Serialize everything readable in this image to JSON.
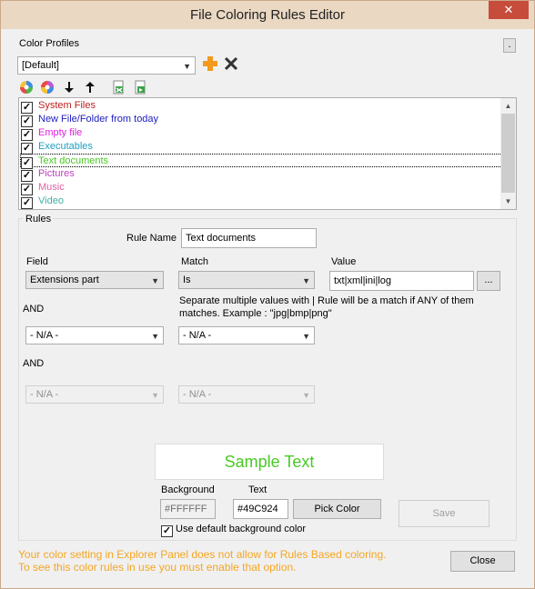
{
  "window": {
    "title": "File Coloring Rules Editor",
    "close_glyph": "✕"
  },
  "profiles": {
    "label": "Color Profiles",
    "dot_button": ".",
    "selected": "[Default]"
  },
  "items": [
    {
      "label": "System Files",
      "color": "#c02020",
      "checked": true
    },
    {
      "label": "New File/Folder from today",
      "color": "#2020c0",
      "checked": true
    },
    {
      "label": "Empty file",
      "color": "#e020e0",
      "checked": true
    },
    {
      "label": "Executables",
      "color": "#20a0c0",
      "checked": true
    },
    {
      "label": "Text documents",
      "color": "#49C924",
      "checked": true
    },
    {
      "label": "Pictures",
      "color": "#c040c0",
      "checked": true
    },
    {
      "label": "Music",
      "color": "#e060a0",
      "checked": true
    },
    {
      "label": "Video",
      "color": "#40b0a0",
      "checked": true
    }
  ],
  "rules": {
    "group_label": "Rules",
    "rule_name_label": "Rule Name",
    "rule_name_value": "Text documents",
    "field_label": "Field",
    "match_label": "Match",
    "value_label": "Value",
    "field_value": "Extensions part",
    "match_value": "Is",
    "value_value": "txt|xml|ini|log",
    "value_browse": "...",
    "hint": "Separate multiple values with | Rule will be a match if ANY of them matches. Example : \"jpg|bmp|png\"",
    "and1": "AND",
    "and2": "AND",
    "na1_field": "- N/A -",
    "na1_match": "- N/A -",
    "na2_field": "- N/A -",
    "na2_match": "- N/A -"
  },
  "sample": {
    "text": "Sample Text",
    "color": "#49C924",
    "background_label": "Background",
    "text_label": "Text",
    "background_value": "#FFFFFF",
    "text_value": "#49C924",
    "pick_color": "Pick Color",
    "save": "Save",
    "use_default_bg": "Use default background color"
  },
  "warning": {
    "line1": "Your color setting in Explorer Panel does not allow for Rules Based coloring.",
    "line2": "To see this color rules in use you must enable that option."
  },
  "close_button": "Close",
  "colors": {
    "accent_orange": "#f5a623",
    "titlebar": "#ead8c3",
    "close_red": "#c74c3c"
  }
}
